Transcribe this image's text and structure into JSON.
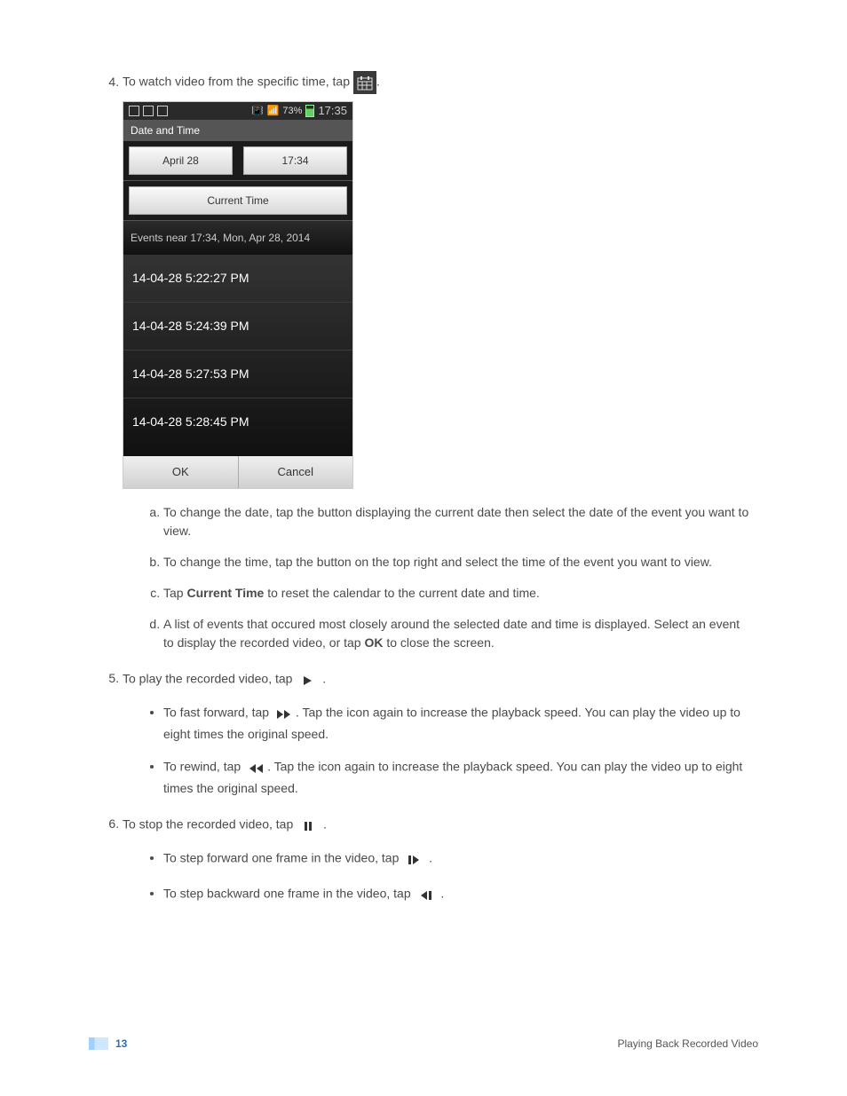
{
  "step4": {
    "text_before": "To watch video from the specific time, tap ",
    "text_after": ".",
    "icon": "calendar-icon"
  },
  "screenshot": {
    "status": {
      "percent": "73%",
      "time": "17:35"
    },
    "title": "Date and Time",
    "date_btn": "April 28",
    "time_btn": "17:34",
    "current_btn": "Current Time",
    "events_header": "Events near 17:34, Mon, Apr 28, 2014",
    "events": [
      "14-04-28  5:22:27 PM",
      "14-04-28  5:24:39 PM",
      "14-04-28  5:27:53 PM",
      "14-04-28  5:28:45 PM"
    ],
    "ok": "OK",
    "cancel": "Cancel"
  },
  "sub4": {
    "a": "To change the date, tap the button displaying the current date then select the date of the event you want to view.",
    "b": "To change the time, tap the button on the top right and select the time of the event you want to view.",
    "c_before": "Tap ",
    "c_bold": "Current Time",
    "c_after": " to reset the calendar to the current date and time.",
    "d_before": "A list of events that occured most closely around the selected date and time is displayed. Select an event to display the recorded video, or tap ",
    "d_bold": "OK",
    "d_after": " to close the screen."
  },
  "step5": {
    "text_before": "To play the recorded video, tap  ",
    "text_after": " .",
    "bullet_ff_before": "To fast forward, tap ",
    "bullet_ff_after": ". Tap the icon again to increase the playback speed. You can play the video up to eight times the original speed.",
    "bullet_rw_before": "To rewind, tap ",
    "bullet_rw_after": ". Tap the icon again to increase the playback speed. You can play the video up to eight times the original speed."
  },
  "step6": {
    "text_before": "To stop the recorded video, tap  ",
    "text_after": " .",
    "bullet_fwd_before": "To step forward one frame in the video, tap  ",
    "bullet_fwd_after": " .",
    "bullet_bwd_before": "To step backward one frame in the video, tap  ",
    "bullet_bwd_after": " ."
  },
  "footer": {
    "page": "13",
    "section": "Playing Back Recorded Video"
  }
}
